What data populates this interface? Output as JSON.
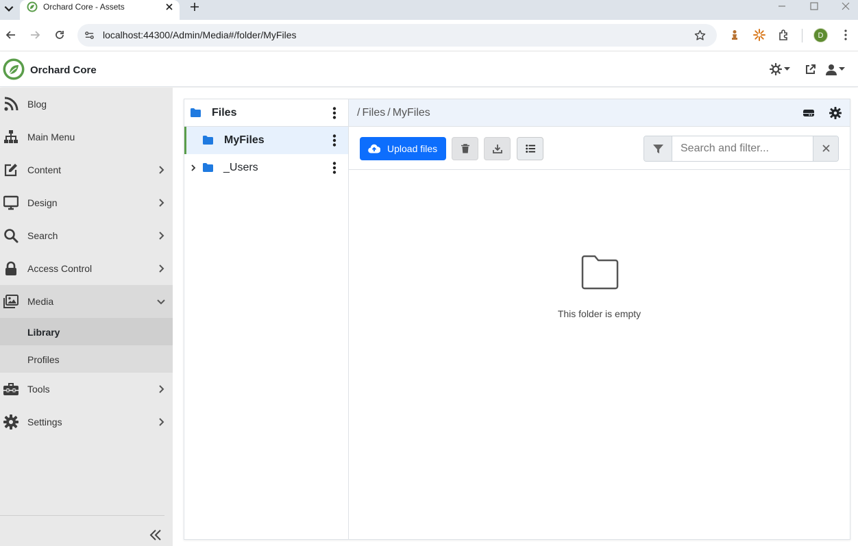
{
  "browser": {
    "tab_title": "Orchard Core - Assets",
    "url": "localhost:44300/Admin/Media#/folder/MyFiles",
    "profile_initial": "D"
  },
  "app": {
    "brand": "Orchard Core",
    "accent_color": "#0d6efd",
    "brand_color": "#5a9d4a"
  },
  "sidebar": {
    "items": [
      {
        "label": "Blog",
        "icon": "rss-icon"
      },
      {
        "label": "Main Menu",
        "icon": "sitemap-icon"
      },
      {
        "label": "Content",
        "icon": "edit-icon"
      },
      {
        "label": "Design",
        "icon": "monitor-icon"
      },
      {
        "label": "Search",
        "icon": "search-icon"
      },
      {
        "label": "Access Control",
        "icon": "lock-icon"
      },
      {
        "label": "Media",
        "icon": "images-icon"
      },
      {
        "label": "Tools",
        "icon": "toolbox-icon"
      },
      {
        "label": "Settings",
        "icon": "gear-icon"
      }
    ],
    "media_children": [
      {
        "label": "Library"
      },
      {
        "label": "Profiles"
      }
    ]
  },
  "media": {
    "tree": {
      "root": "Files",
      "children": [
        {
          "label": "MyFiles"
        },
        {
          "label": "_Users"
        }
      ]
    },
    "breadcrumb": [
      "Files",
      "MyFiles"
    ],
    "breadcrumb_sep": "/",
    "upload_label": "Upload files",
    "search_placeholder": "Search and filter...",
    "empty_message": "This folder is empty"
  }
}
